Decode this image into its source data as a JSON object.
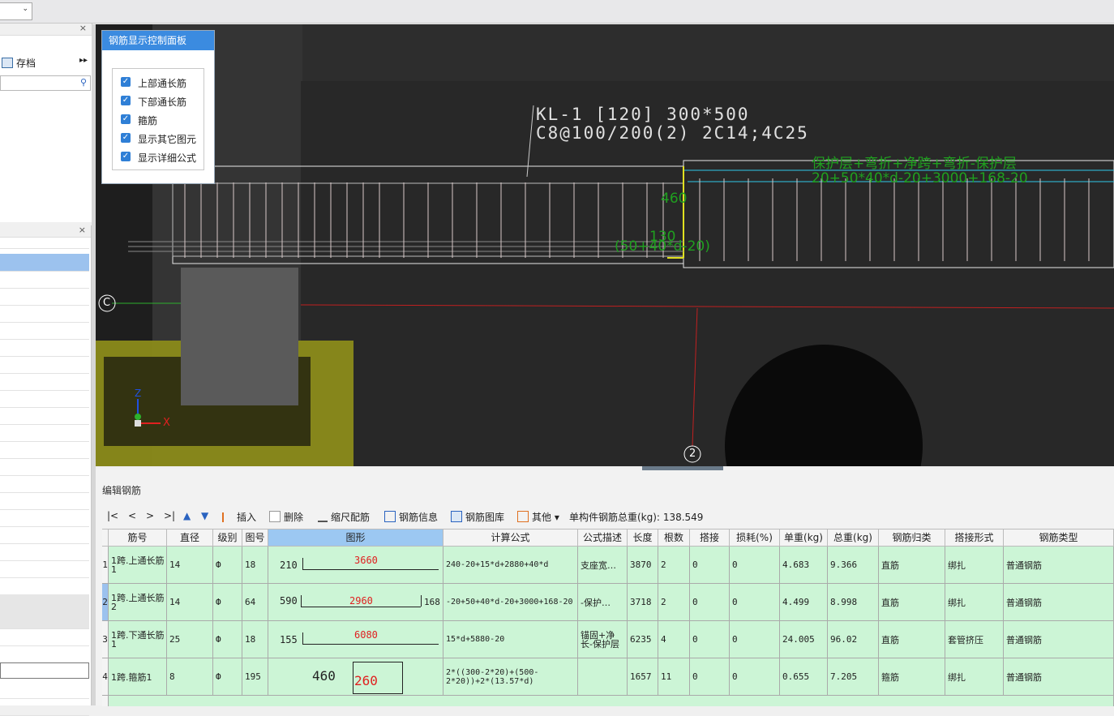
{
  "topbar": {
    "combo_arrow": "⌄"
  },
  "left_panel": {
    "close1": "×",
    "close2": "×",
    "archive_label": "存档",
    "archive_more": "▸▸"
  },
  "control_panel": {
    "title": "钢筋显示控制面板",
    "options": [
      {
        "label": "上部通长筋",
        "checked": true
      },
      {
        "label": "下部通长筋",
        "checked": true
      },
      {
        "label": "箍筋",
        "checked": true
      },
      {
        "label": "显示其它图元",
        "checked": true
      },
      {
        "label": "显示详细公式",
        "checked": true
      }
    ]
  },
  "viewport": {
    "beam_label_line1": "KL-1 [120] 300*500",
    "beam_label_line2": "C8@100/200(2) 2C14;4C25",
    "annot_top1": "保护层+弯折+净跨+弯折-保护层",
    "annot_top2": "20+50*40*d-20+3000+168-20",
    "dim_460": "460",
    "dim_130": "130",
    "dim_formula": "(50+40*d-20)",
    "axis_c": "C",
    "axis_2": "2",
    "axis_z": "Z",
    "axis_x": "X"
  },
  "editor": {
    "title": "编辑钢筋",
    "nav": [
      "|<",
      "<",
      ">",
      ">|"
    ],
    "buttons": {
      "insert": "插入",
      "delete": "删除",
      "scale": "缩尺配筋",
      "info": "钢筋信息",
      "library": "钢筋图库",
      "other": "其他",
      "other_arrow": "▾"
    },
    "total_weight_label": "单构件钢筋总重(kg):",
    "total_weight_value": "138.549",
    "columns": [
      "筋号",
      "直径(mm)",
      "级别",
      "图号",
      "图形",
      "计算公式",
      "公式描述",
      "长度",
      "根数",
      "搭接",
      "损耗(%)",
      "单重(kg)",
      "总重(kg)",
      "钢筋归类",
      "搭接形式",
      "钢筋类型"
    ],
    "rows": [
      {
        "idx": "1",
        "name": "1跨.上通长筋1",
        "dia": "14",
        "grade": "Ф",
        "fig": "18",
        "shape_left": "210",
        "shape_mid": "3660",
        "shape_right": "",
        "formula": "240-20+15*d+2880+40*d",
        "desc": "支座宽…",
        "len": "3870",
        "count": "2",
        "lap": "0",
        "loss": "0",
        "unit_w": "4.683",
        "total_w": "9.366",
        "cat": "直筋",
        "lap_type": "绑扎",
        "type": "普通钢筋"
      },
      {
        "idx": "2",
        "name": "1跨.上通长筋2",
        "dia": "14",
        "grade": "Ф",
        "fig": "64",
        "shape_left": "590",
        "shape_mid": "2960",
        "shape_right": "168",
        "formula": "-20+50+40*d-20+3000+168-20",
        "desc": "-保护…",
        "len": "3718",
        "count": "2",
        "lap": "0",
        "loss": "0",
        "unit_w": "4.499",
        "total_w": "8.998",
        "cat": "直筋",
        "lap_type": "绑扎",
        "type": "普通钢筋"
      },
      {
        "idx": "3",
        "name": "1跨.下通长筋1",
        "dia": "25",
        "grade": "Ф",
        "fig": "18",
        "shape_left": "155",
        "shape_mid": "6080",
        "shape_right": "",
        "formula": "15*d+5880-20",
        "desc": "锚固+净长-保护层",
        "len": "6235",
        "count": "4",
        "lap": "0",
        "loss": "0",
        "unit_w": "24.005",
        "total_w": "96.02",
        "cat": "直筋",
        "lap_type": "套管挤压",
        "type": "普通钢筋"
      },
      {
        "idx": "4",
        "name": "1跨.箍筋1",
        "dia": "8",
        "grade": "Ф",
        "fig": "195",
        "shape_left": "460",
        "shape_mid": "260",
        "shape_right": "",
        "formula": "2*((300-2*20)+(500-2*20))+2*(13.57*d)",
        "desc": "",
        "len": "1657",
        "count": "11",
        "lap": "0",
        "loss": "0",
        "unit_w": "0.655",
        "total_w": "7.205",
        "cat": "箍筋",
        "lap_type": "绑扎",
        "type": "普通钢筋"
      }
    ]
  },
  "colors": {
    "accent": "#3b8be0",
    "row_green": "#ccf5d6",
    "rebar_red": "#e02020",
    "annot_green": "#1fa01f"
  }
}
